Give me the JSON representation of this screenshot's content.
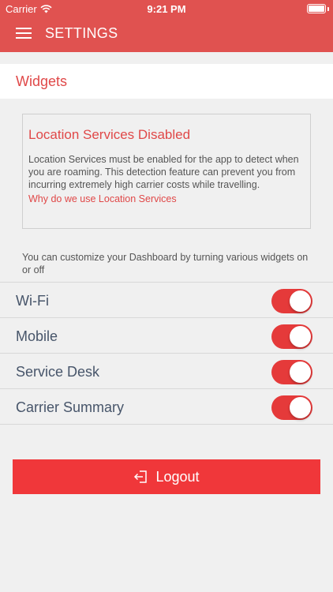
{
  "status_bar": {
    "carrier": "Carrier",
    "time": "9:21 PM"
  },
  "nav": {
    "title": "SETTINGS"
  },
  "section": {
    "title": "Widgets"
  },
  "location_notice": {
    "title": "Location Services Disabled",
    "body": "Location Services must be enabled for the app to detect when you are roaming. This detection feature can prevent you from incurring extremely high carrier costs while travelling.",
    "link": "Why do we use Location Services"
  },
  "helper_text": "You can customize your Dashboard by turning various widgets on or off",
  "widgets": [
    {
      "label": "Wi-Fi",
      "enabled": true
    },
    {
      "label": "Mobile",
      "enabled": true
    },
    {
      "label": "Service Desk",
      "enabled": true
    },
    {
      "label": "Carrier Summary",
      "enabled": true
    }
  ],
  "logout": {
    "label": "Logout"
  },
  "colors": {
    "brand": "#e05250",
    "accent_text": "#e04848",
    "toggle_on": "#e53a3a",
    "logout": "#f0373a"
  },
  "icons": {
    "menu": "hamburger-icon",
    "logout": "logout-icon",
    "wifi": "wifi-icon",
    "battery": "battery-icon"
  }
}
